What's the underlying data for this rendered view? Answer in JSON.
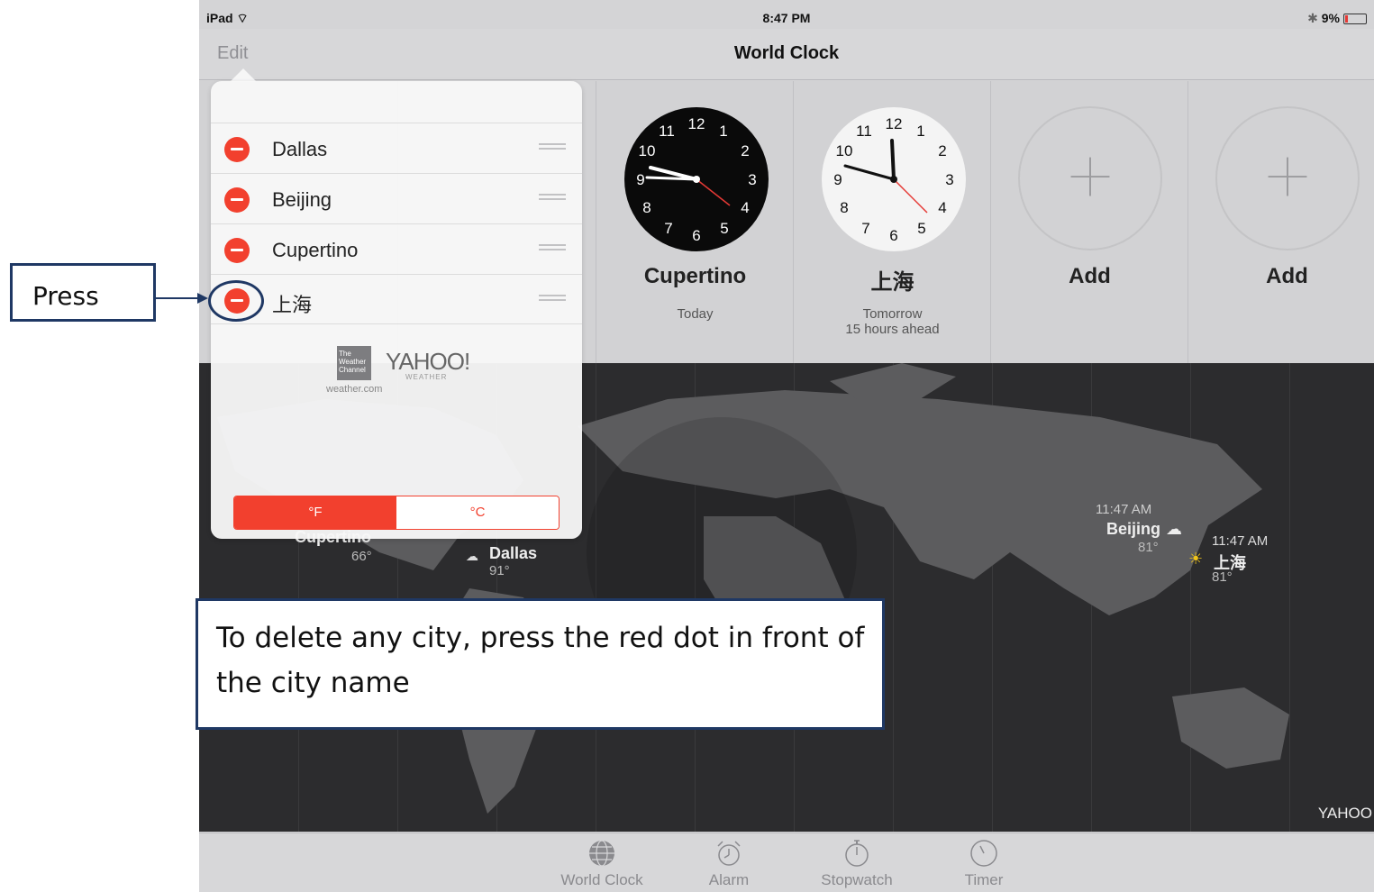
{
  "status_bar": {
    "device": "iPad",
    "time": "8:47 PM",
    "battery": "9%"
  },
  "nav": {
    "edit_label": "Edit",
    "title": "World Clock"
  },
  "clocks": [
    {
      "city": "Cupertino",
      "sub1": "Today",
      "sub2": ""
    },
    {
      "city": "上海",
      "sub1": "Tomorrow",
      "sub2": "15 hours ahead"
    },
    {
      "city": "Add",
      "sub1": "",
      "sub2": ""
    },
    {
      "city": "Add",
      "sub1": "",
      "sub2": ""
    }
  ],
  "popover": {
    "cities": [
      "Dallas",
      "Beijing",
      "Cupertino",
      "上海"
    ],
    "twc": "The Weather Channel",
    "yahoo": "YAHOO!",
    "yahoo_sub": "WEATHER",
    "weather_url": "weather.com",
    "unit_f": "°F",
    "unit_c": "°C"
  },
  "map": {
    "cupertino_city": "Cupertino",
    "cupertino_temp": "66°",
    "dallas_city": "Dallas",
    "dallas_temp": "91°",
    "beijing_time": "11:47 AM",
    "beijing_city": "Beijing",
    "beijing_temp": "81°",
    "shanghai_time": "11:47 AM",
    "shanghai_city": "上海",
    "shanghai_temp": "81°",
    "yahoo_logo": "YAHOO"
  },
  "tabs": [
    "World Clock",
    "Alarm",
    "Stopwatch",
    "Timer"
  ],
  "annotations": {
    "press": "Press",
    "tip": "To delete any city, press the red dot in front of the city name"
  },
  "colors": {
    "delete_red": "#f2402e",
    "annotation_border": "#1f3864"
  }
}
